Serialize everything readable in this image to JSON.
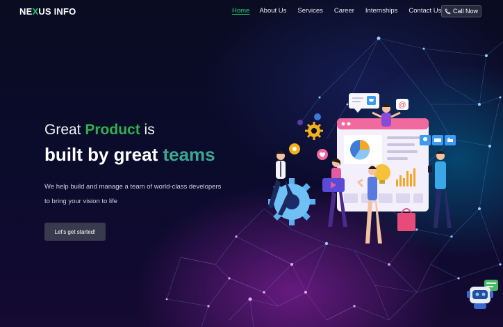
{
  "brand": {
    "logo_prefix": "NE",
    "logo_x": "X",
    "logo_suffix": "US INFO"
  },
  "nav": {
    "items": [
      {
        "label": "Home",
        "active": true
      },
      {
        "label": "About Us",
        "active": false
      },
      {
        "label": "Services",
        "active": false
      },
      {
        "label": "Career",
        "active": false
      },
      {
        "label": "Internships",
        "active": false
      },
      {
        "label": "Contact Us",
        "active": false
      }
    ],
    "call_label": "Call Now"
  },
  "hero": {
    "line1_pre": "Great ",
    "line1_accent": "Product",
    "line1_post": " is",
    "line2_pre": "built by great ",
    "line2_accent": "teams",
    "subtitle_line1": "We help build and manage a team of world-class developers",
    "subtitle_line2": "to bring your vision to life",
    "cta_label": "Let's get started!"
  },
  "illustration": {
    "at_symbol": "@"
  },
  "colors": {
    "brand_green": "#22d36b",
    "nav_active": "#2bd46a",
    "product_green": "#2fb050",
    "teams_teal": "#3aa88f",
    "background": "#0a0a2a"
  },
  "icons": [
    "phone-icon",
    "gear-icon",
    "chat-bot-icon",
    "shopping-bag-icon",
    "pie-chart-icon",
    "cart-icon",
    "like-icon",
    "heart-icon",
    "user-icon",
    "message-icon",
    "video-icon"
  ]
}
